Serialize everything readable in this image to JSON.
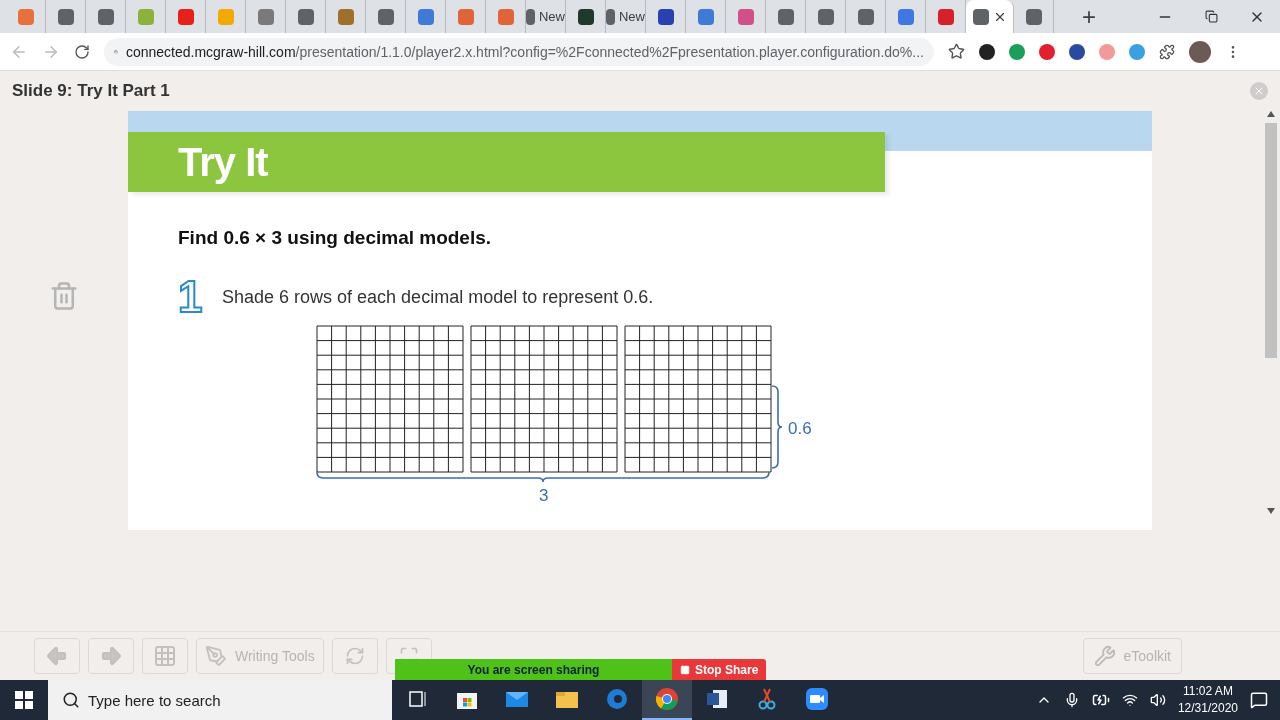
{
  "browser": {
    "tabs": [
      {
        "color": "#e8703a",
        "selected": false
      },
      {
        "color": "#5f6368",
        "selected": false
      },
      {
        "color": "#5f6368",
        "selected": false
      },
      {
        "color": "#8bb33b",
        "selected": false
      },
      {
        "color": "#e62117",
        "selected": false
      },
      {
        "color": "#f2a900",
        "selected": false
      },
      {
        "color": "#7a7a7a",
        "selected": false
      },
      {
        "color": "#5f6368",
        "selected": false
      },
      {
        "color": "#a0702a",
        "selected": false
      },
      {
        "color": "#5f6368",
        "selected": false
      },
      {
        "color": "#3f7ad6",
        "selected": false
      },
      {
        "color": "#e0643a",
        "selected": false
      },
      {
        "color": "#e0643a",
        "selected": false
      },
      {
        "color": "#5f6368",
        "label": "New",
        "selected": false
      },
      {
        "color": "#1e3a2a",
        "selected": false
      },
      {
        "color": "#5f6368",
        "label": "New",
        "selected": false
      },
      {
        "color": "#2a3fb0",
        "selected": false
      },
      {
        "color": "#3f7ad6",
        "selected": false
      },
      {
        "color": "#d0508a",
        "selected": false
      },
      {
        "color": "#5f6368",
        "selected": false
      },
      {
        "color": "#5f6368",
        "selected": false
      },
      {
        "color": "#5f6368",
        "selected": false
      },
      {
        "color": "#3f78e0",
        "selected": false
      },
      {
        "color": "#d6202a",
        "selected": false
      },
      {
        "color": "#5f6368",
        "selected": true
      },
      {
        "color": "#5f6368",
        "selected": false
      }
    ],
    "new_tab": "+",
    "url_host": "connected.mcgraw-hill.com",
    "url_path": "/presentation/1.1.0/player2.x.html?config=%2Fconnected%2Fpresentation.player.configuration.do%...",
    "extensions": [
      {
        "color": "#222222"
      },
      {
        "color": "#1a9e5a"
      },
      {
        "color": "#e02030"
      },
      {
        "color": "#2a4aa0"
      },
      {
        "color": "#f29a9a"
      },
      {
        "color": "#3aa0e0"
      }
    ]
  },
  "slide": {
    "title": "Slide 9: Try It Part 1",
    "banner": "Try It",
    "prompt": "Find 0.6 × 3 using decimal models.",
    "step_number": "1",
    "step_text": "Shade 6 rows of each decimal model to represent 0.6.",
    "models": [
      {
        "kind": "grid"
      },
      {
        "kind": "grid"
      },
      {
        "kind": "grid"
      }
    ],
    "height_label": "0.6",
    "width_label": "3"
  },
  "toolbar": {
    "buttons": [
      {
        "kind": "prev"
      },
      {
        "kind": "next"
      },
      {
        "kind": "grid"
      },
      {
        "kind": "writing",
        "label": "Writing Tools"
      },
      {
        "kind": "refresh"
      },
      {
        "kind": "fullscreen"
      }
    ],
    "etoolkit": "eToolkit"
  },
  "screen_share": {
    "message": "You are screen sharing",
    "stop": "Stop Share"
  },
  "taskbar": {
    "search_placeholder": "Type here to search",
    "apps": [
      {
        "kind": "taskview",
        "selected": false
      },
      {
        "kind": "store",
        "selected": false
      },
      {
        "kind": "mail",
        "selected": false
      },
      {
        "kind": "folder",
        "selected": false
      },
      {
        "kind": "edge",
        "selected": false
      },
      {
        "kind": "chrome",
        "selected": true
      },
      {
        "kind": "word",
        "selected": false
      },
      {
        "kind": "snip",
        "selected": false
      },
      {
        "kind": "zoom",
        "selected": false
      }
    ],
    "time": "11:02 AM",
    "date": "12/31/2020"
  }
}
